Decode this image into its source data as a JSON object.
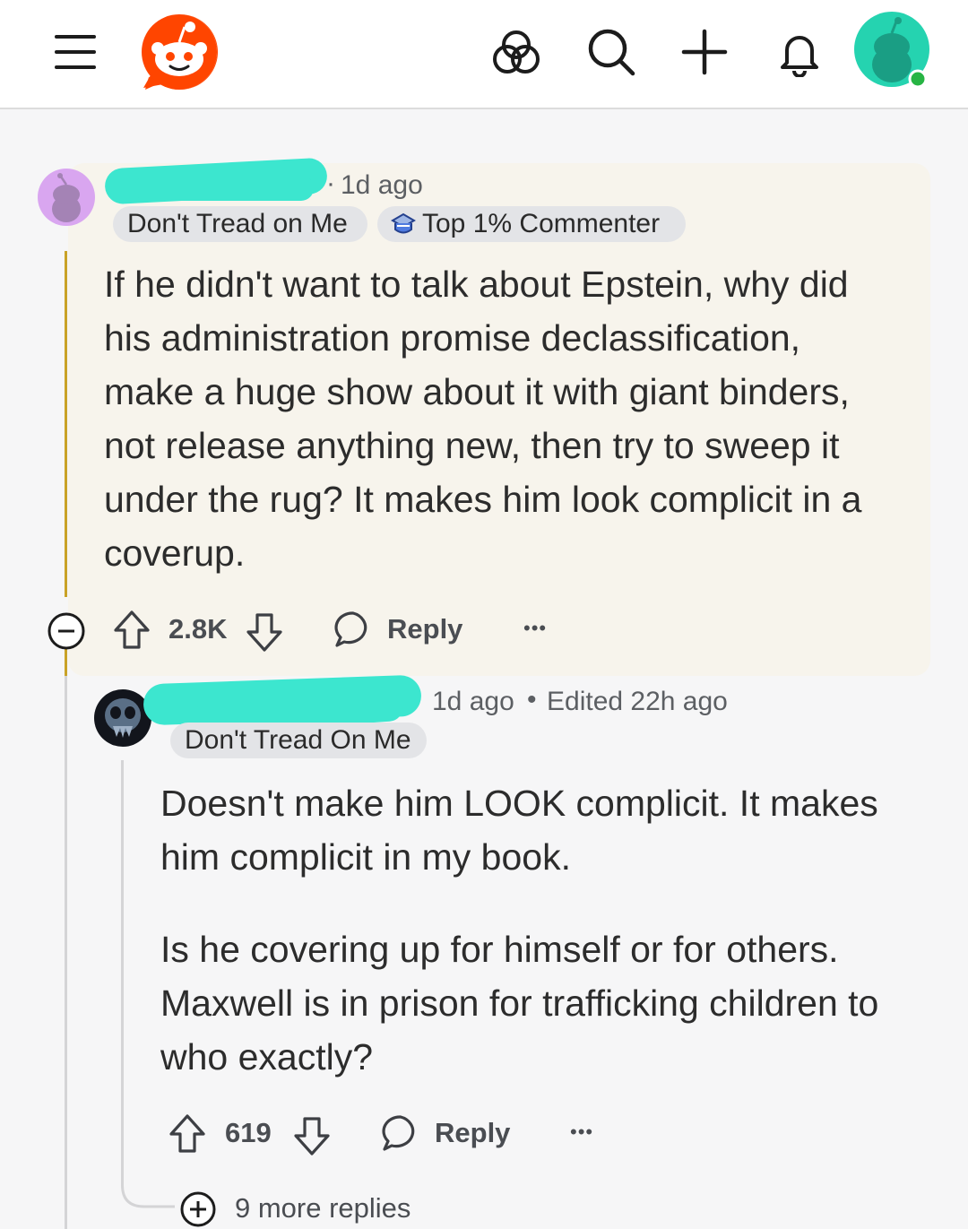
{
  "nav": {
    "menu_icon": "hamburger-menu-icon",
    "logo_icon": "reddit-logo-icon",
    "actions": [
      "communities-icon",
      "search-icon",
      "create-post-icon",
      "notifications-bell-icon",
      "user-avatar"
    ],
    "accent": "#ff4500",
    "avatar_color": "#25d3b0",
    "online_color": "#27b444"
  },
  "comment": {
    "time": "1d ago",
    "flair": "Don't Tread on Me",
    "badge": "Top 1% Commenter",
    "body": [
      "If he didn't want to talk about Epstein, why did",
      "his administration promise declassification,",
      "make a huge show about it with giant binders,",
      "not release anything new, then try to sweep it",
      "under the rug? It makes him look complicit in a",
      "coverup."
    ],
    "votes": "2.8K",
    "reply_label": "Reply",
    "more_label": "•••",
    "thread_color": "#c9a227",
    "card_bg": "#f7f4ec"
  },
  "reply": {
    "time": "1d ago",
    "edited": "Edited 22h ago",
    "flair": "Don't Tread On Me",
    "paragraph1": [
      "Doesn't make him LOOK complicit. It makes",
      "him complicit in my book."
    ],
    "paragraph2": [
      "Is he covering up for himself or for others.",
      "Maxwell is in prison for trafficking children to",
      "who exactly?"
    ],
    "votes": "619",
    "reply_label": "Reply",
    "more_label": "•••",
    "more_replies": "9 more replies"
  }
}
